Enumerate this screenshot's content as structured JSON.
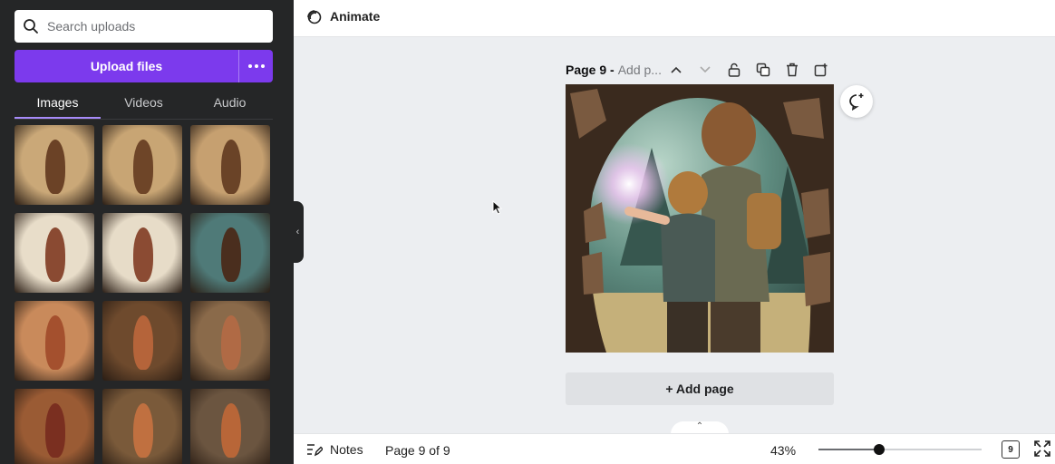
{
  "sidebar": {
    "search_placeholder": "Search uploads",
    "upload_label": "Upload files",
    "tabs": [
      {
        "label": "Images",
        "active": true
      },
      {
        "label": "Videos",
        "active": false
      },
      {
        "label": "Audio",
        "active": false
      }
    ],
    "thumbnails": [
      {
        "bg": "#caa878",
        "fg": "#6b4226"
      },
      {
        "bg": "#c8a574",
        "fg": "#6e4528"
      },
      {
        "bg": "#c6a070",
        "fg": "#6a4327"
      },
      {
        "bg": "#e8ddc9",
        "fg": "#8a4a32"
      },
      {
        "bg": "#e7dcc8",
        "fg": "#8b4b33"
      },
      {
        "bg": "#4f7a78",
        "fg": "#4a2e1e"
      },
      {
        "bg": "#c98a5b",
        "fg": "#a4502e"
      },
      {
        "bg": "#6e4a2d",
        "fg": "#b5643a"
      },
      {
        "bg": "#8a6a4a",
        "fg": "#b06a45"
      },
      {
        "bg": "#9a5b34",
        "fg": "#7a2f20"
      },
      {
        "bg": "#7a5a3a",
        "fg": "#c07040"
      },
      {
        "bg": "#6b5540",
        "fg": "#b86638"
      }
    ]
  },
  "topbar": {
    "animate_label": "Animate"
  },
  "page": {
    "title": "Page 9 -",
    "subtitle": "Add p...",
    "add_page_label": "+ Add page"
  },
  "bottombar": {
    "notes_label": "Notes",
    "page_count": "Page 9 of 9",
    "zoom": "43%",
    "zoom_fraction": 0.37,
    "grid_count": "9"
  },
  "colors": {
    "sidebar_bg": "#252627",
    "accent": "#7c3aed",
    "tab_underline": "#a78bfa"
  }
}
